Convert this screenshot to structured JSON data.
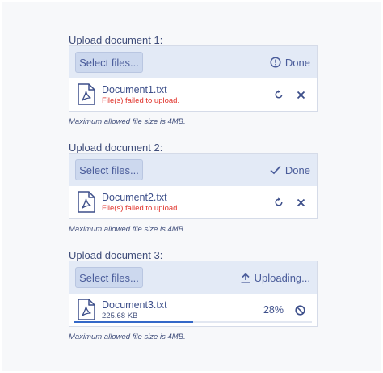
{
  "uploads": [
    {
      "label": "Upload document 1:",
      "select_button": "Select files...",
      "status": {
        "text": "Done",
        "icon": "alert-circle-icon"
      },
      "file": {
        "name": "Document1.txt",
        "subtext": "File(s) failed to upload.",
        "state": "error"
      },
      "actions": [
        "retry-icon",
        "close-icon"
      ],
      "hint": "Maximum allowed file size is 4MB."
    },
    {
      "label": "Upload document 2:",
      "select_button": "Select files...",
      "status": {
        "text": "Done",
        "icon": "check-icon"
      },
      "file": {
        "name": "Document2.txt",
        "subtext": "File(s) failed to upload.",
        "state": "error"
      },
      "actions": [
        "retry-icon",
        "close-icon"
      ],
      "hint": "Maximum allowed file size is 4MB."
    },
    {
      "label": "Upload document 3:",
      "select_button": "Select files...",
      "status": {
        "text": "Uploading...",
        "icon": "upload-icon"
      },
      "file": {
        "name": "Document3.txt",
        "subtext": "225.68 KB",
        "state": "uploading",
        "progress_text": "28%",
        "progress": 0.5
      },
      "actions": [
        "cancel-icon"
      ],
      "hint": "Maximum allowed file size is 4MB."
    }
  ],
  "colors": {
    "accent": "#4a5c9a",
    "error": "#e0322a",
    "toolbar_bg": "#e3eaf6",
    "progress": "#3468c8"
  }
}
